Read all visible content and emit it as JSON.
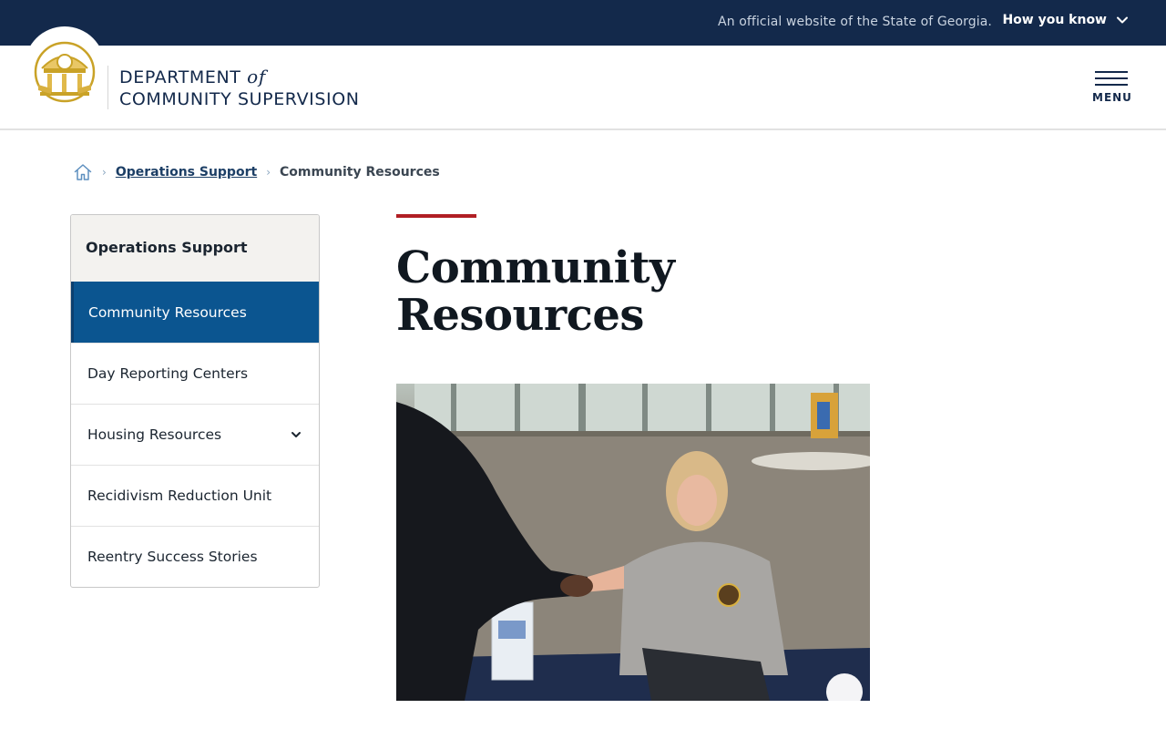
{
  "banner": {
    "official_text": "An official website of the State of Georgia.",
    "how_you_know": "How you know"
  },
  "header": {
    "logo_line1": "DEPARTMENT",
    "logo_of": "of",
    "logo_line2": "COMMUNITY SUPERVISION",
    "menu_label": "MENU"
  },
  "breadcrumb": {
    "parent": "Operations Support",
    "current": "Community Resources"
  },
  "sidenav": {
    "heading": "Operations Support",
    "items": [
      {
        "label": "Community Resources",
        "active": true
      },
      {
        "label": "Day Reporting Centers"
      },
      {
        "label": "Housing Resources",
        "has_submenu": true
      },
      {
        "label": "Recidivism Reduction Unit"
      },
      {
        "label": "Reentry Success Stories"
      }
    ]
  },
  "main": {
    "title_line1": "Community",
    "title_line2": "Resources"
  },
  "colors": {
    "banner_bg": "#13294b",
    "active_nav": "#0b5590",
    "accent_rule": "#b11f24",
    "seal_gold": "#c9a227"
  },
  "icons": [
    "chevron-down-icon",
    "menu-icon",
    "home-icon",
    "seal-logo"
  ]
}
